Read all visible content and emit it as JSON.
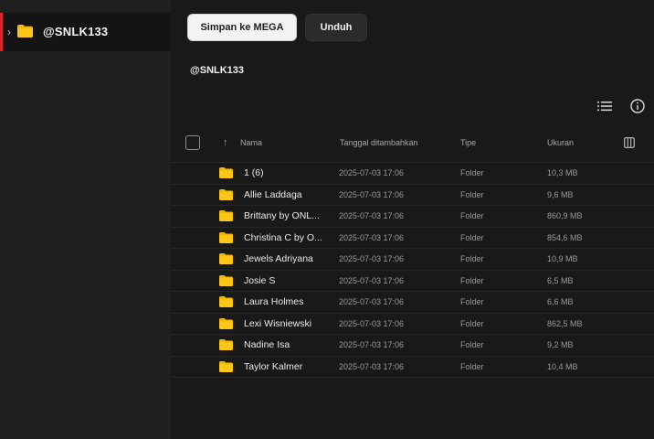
{
  "sidebar": {
    "items": [
      {
        "label": "@SNLK133",
        "icon": "folder-icon",
        "expand_icon": "chevron-right-icon"
      }
    ]
  },
  "toolbar": {
    "save_label": "Simpan ke MEGA",
    "download_label": "Unduh"
  },
  "header": {
    "title": "@SNLK133"
  },
  "table": {
    "columns": {
      "name": "Nama",
      "date": "Tanggal ditambahkan",
      "type": "Tipe",
      "size": "Ukuran"
    },
    "rows": [
      {
        "name": "1 (6)",
        "date": "2025-07-03 17:06",
        "type": "Folder",
        "size": "10,3 MB"
      },
      {
        "name": "Allie Laddaga",
        "date": "2025-07-03 17:06",
        "type": "Folder",
        "size": "9,6 MB"
      },
      {
        "name": "Brittany by ONL...",
        "date": "2025-07-03 17:06",
        "type": "Folder",
        "size": "860,9 MB"
      },
      {
        "name": "Christina C by O...",
        "date": "2025-07-03 17:06",
        "type": "Folder",
        "size": "854,6 MB"
      },
      {
        "name": "Jewels Adriyana",
        "date": "2025-07-03 17:06",
        "type": "Folder",
        "size": "10,9 MB"
      },
      {
        "name": "Josie S",
        "date": "2025-07-03 17:06",
        "type": "Folder",
        "size": "6,5 MB"
      },
      {
        "name": "Laura Holmes",
        "date": "2025-07-03 17:06",
        "type": "Folder",
        "size": "6,6 MB"
      },
      {
        "name": "Lexi Wisniewski",
        "date": "2025-07-03 17:06",
        "type": "Folder",
        "size": "862,5 MB"
      },
      {
        "name": "Nadine Isa",
        "date": "2025-07-03 17:06",
        "type": "Folder",
        "size": "9,2 MB"
      },
      {
        "name": "Taylor Kalmer",
        "date": "2025-07-03 17:06",
        "type": "Folder",
        "size": "10,4 MB"
      }
    ]
  },
  "colors": {
    "accent": "#d9272e",
    "folder": "#f5b800",
    "background": "#191919",
    "sidebar": "#1f1f1f"
  }
}
